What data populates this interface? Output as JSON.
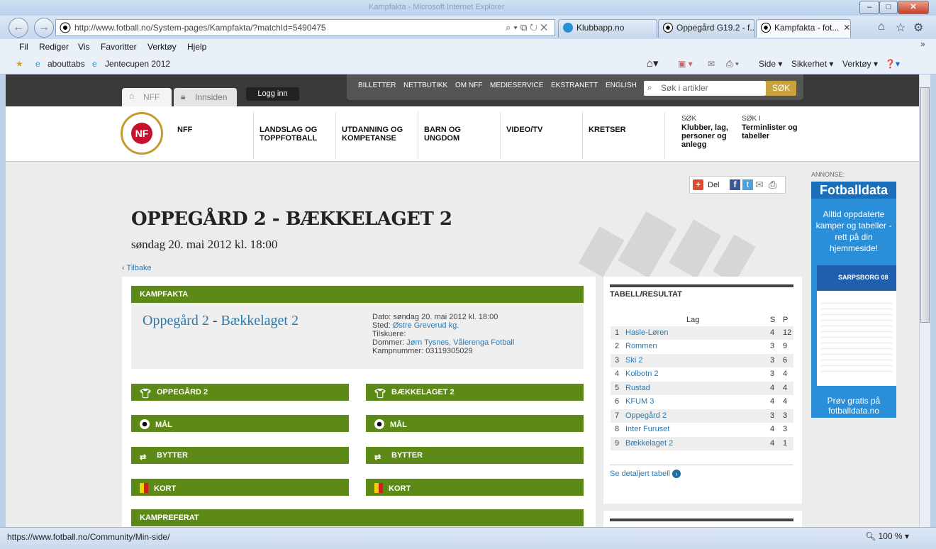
{
  "window": {
    "title": "Kampfakta - Microsoft Internet Explorer",
    "controls": {
      "min": "–",
      "max": "□",
      "close": "✕"
    }
  },
  "address": {
    "url": "http://www.fotball.no/System-pages/Kampfakta/?matchId=5490475"
  },
  "tabs": [
    {
      "label": "Klubbapp.no"
    },
    {
      "label": "Oppegård G19.2 - f..."
    },
    {
      "label": "Kampfakta - fot..."
    }
  ],
  "menu": [
    "Fil",
    "Rediger",
    "Vis",
    "Favoritter",
    "Verktøy",
    "Hjelp"
  ],
  "favorites": [
    "abouttabs",
    "Jentecupen 2012"
  ],
  "command_bar": {
    "side": "Side ▾",
    "sikkerhet": "Sikkerhet ▾",
    "verktoy": "Verktøy ▾"
  },
  "status": {
    "url": "https://www.fotball.no/Community/Min-side/",
    "zoom": "100 %"
  },
  "site": {
    "tab_nff": "NFF",
    "tab_innsiden": "Innsiden",
    "login": "Logg inn",
    "topmenu": [
      "BILLETTER",
      "NETTBUTIKK",
      "OM NFF",
      "MEDIESERVICE",
      "EKSTRANETT",
      "ENGLISH"
    ],
    "search_placeholder": "Søk i artikler",
    "search_button": "SØK",
    "nav": [
      {
        "label": "NFF"
      },
      {
        "label": "LANDSLAG OG\nTOPPFOTBALL"
      },
      {
        "label": "UTDANNING OG\nKOMPETANSE"
      },
      {
        "label": "BARN OG\nUNGDOM"
      },
      {
        "label": "VIDEO/TV"
      },
      {
        "label": "KRETSER"
      }
    ],
    "search_clubs_small": "SØK",
    "search_clubs": "Klubber, lag,\npersoner og\nanlegg",
    "search_terminlister_small": "SØK I",
    "search_terminlister": "Terminlister og\ntabeller",
    "share_label": "Del"
  },
  "match": {
    "title": "OPPEGÅRD 2 - BÆKKELAGET 2",
    "date": "søndag 20. mai 2012 kl. 18:00",
    "back": "‹ Tilbake",
    "kampfakta_label": "KAMPFAKTA",
    "home": "Oppegård 2",
    "sep": "-",
    "away": "Bækkelaget 2",
    "dato": "Dato: søndag 20. mai 2012 kl. 18:00",
    "sted_label": "Sted: ",
    "sted": "Østre Greverud kg.",
    "tilskuere": "Tilskuere:",
    "dommer_label": "Dommer: ",
    "dommer": "Jørn Tysnes, Vålerenga Fotball",
    "kampnummer": "Kampnummer: 03119305029",
    "home_upper": "OPPEGÅRD 2",
    "away_upper": "BÆKKELAGET 2",
    "mal": "MÅL",
    "bytter": "BYTTER",
    "kort": "KORT",
    "kampreferat": "KAMPREFERAT"
  },
  "table": {
    "title": "TABELL/RESULTAT",
    "col_lag": "Lag",
    "col_s": "S",
    "col_p": "P",
    "rows": [
      {
        "n": "1",
        "lag": "Hasle-Løren",
        "s": "4",
        "p": "12"
      },
      {
        "n": "2",
        "lag": "Rommen",
        "s": "3",
        "p": "9"
      },
      {
        "n": "3",
        "lag": "Ski 2",
        "s": "3",
        "p": "6"
      },
      {
        "n": "4",
        "lag": "Kolbotn 2",
        "s": "3",
        "p": "4"
      },
      {
        "n": "5",
        "lag": "Rustad",
        "s": "4",
        "p": "4"
      },
      {
        "n": "6",
        "lag": "KFUM 3",
        "s": "4",
        "p": "4"
      },
      {
        "n": "7",
        "lag": "Oppegård 2",
        "s": "3",
        "p": "3"
      },
      {
        "n": "8",
        "lag": "Inter Furuset",
        "s": "4",
        "p": "3"
      },
      {
        "n": "9",
        "lag": "Bækkelaget 2",
        "s": "4",
        "p": "1"
      }
    ],
    "detail_link": "Se detaljert tabell"
  },
  "ad": {
    "label": "ANNONSE:",
    "title": "Fotballdata",
    "text": "Alltid oppdaterte kamper og tabeller - rett på din hjemmeside!",
    "club": "SARPSBORG 08",
    "cta": "Prøv gratis på fotballdata.no"
  },
  "colors": {
    "green": "#5d8a16",
    "link": "#2a7ab0",
    "gold": "#c8a23c"
  }
}
